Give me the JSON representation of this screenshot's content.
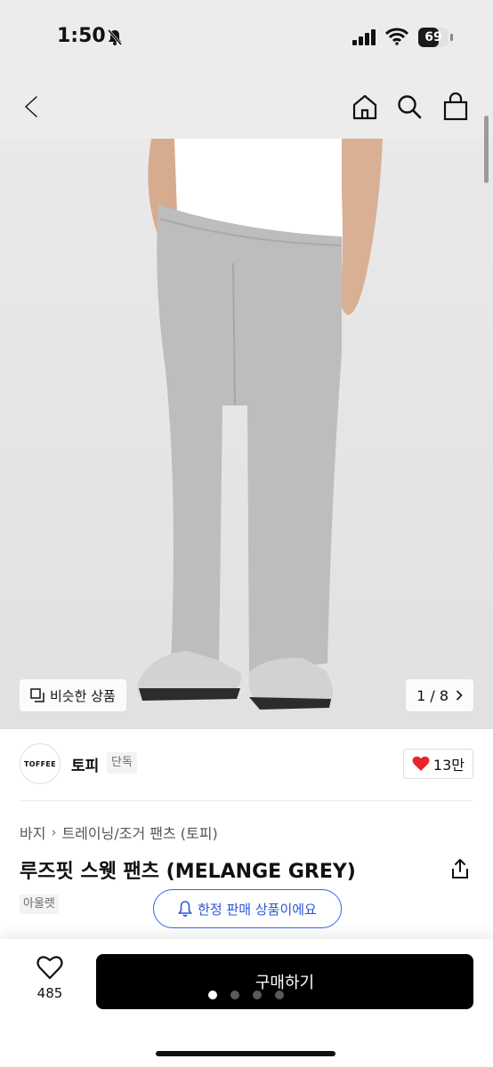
{
  "status_bar": {
    "time": "1:50",
    "battery": "69",
    "battery_level": 0.69
  },
  "nav": {
    "back_icon": "back-chevron-icon",
    "home_icon": "home-icon",
    "search_icon": "search-icon",
    "cart_icon": "shopping-bag-icon"
  },
  "gallery": {
    "similar_label": "비슷한 상품",
    "counter": "1 / 8",
    "current_page": 1,
    "total_pages": 8
  },
  "brand": {
    "logo_text": "TOFFEE",
    "name": "토피",
    "badge": "단독",
    "likes": "13만"
  },
  "breadcrumb": {
    "category": "바지",
    "subcategory": "트레이닝/조거 팬츠 (토피)"
  },
  "product": {
    "title": "루즈핏 스웻 팬츠 (MELANGE GREY)",
    "badge": "아울렛",
    "limited_label": "한정 판매 상품이에요"
  },
  "bottom": {
    "wish_count": "485",
    "buy_label": "구매하기",
    "carousel_dots": 4,
    "active_dot": 1
  },
  "colors": {
    "accent_blue": "#2b55d9",
    "heart_red": "#e8242c",
    "buy_button": "#000000",
    "image_bg": "#e5e5e7",
    "pants_grey": "#bcbcbc"
  }
}
